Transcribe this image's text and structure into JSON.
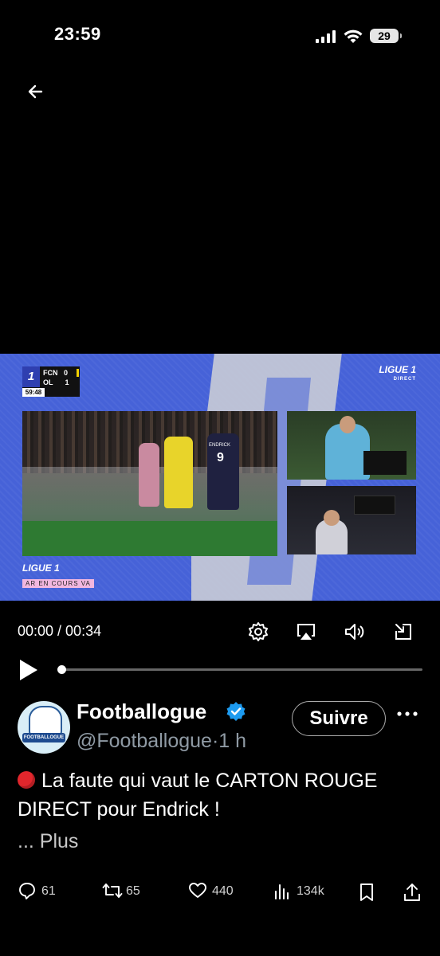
{
  "status_bar": {
    "time": "23:59",
    "battery": "29"
  },
  "video": {
    "scoreboard": {
      "team1": "FCN",
      "score1": "0",
      "team2": "OL",
      "score2": "1",
      "clock": "59:48",
      "logo": "1"
    },
    "brand_top_right": "LIGUE 1",
    "brand_top_right_sub": "DIRECT",
    "brand_bottom_left": "LIGUE 1",
    "ticker": "AR EN COURS VA",
    "player_number": "9",
    "player_name": "ENDRICK"
  },
  "player_controls": {
    "time": "00:00 / 00:34",
    "progress": 0
  },
  "tweet": {
    "author": "Footballogue",
    "handle": "@Footballogue",
    "separator": "·",
    "age": "1 h",
    "follow_label": "Suivre",
    "text": "La faute qui vaut le CARTON ROUGE DIRECT pour Endrick !",
    "more_label": "... Plus",
    "avatar_text": "FOOTBALLOGUE"
  },
  "actions": {
    "replies": "61",
    "reposts": "65",
    "likes": "440",
    "views": "134k"
  }
}
